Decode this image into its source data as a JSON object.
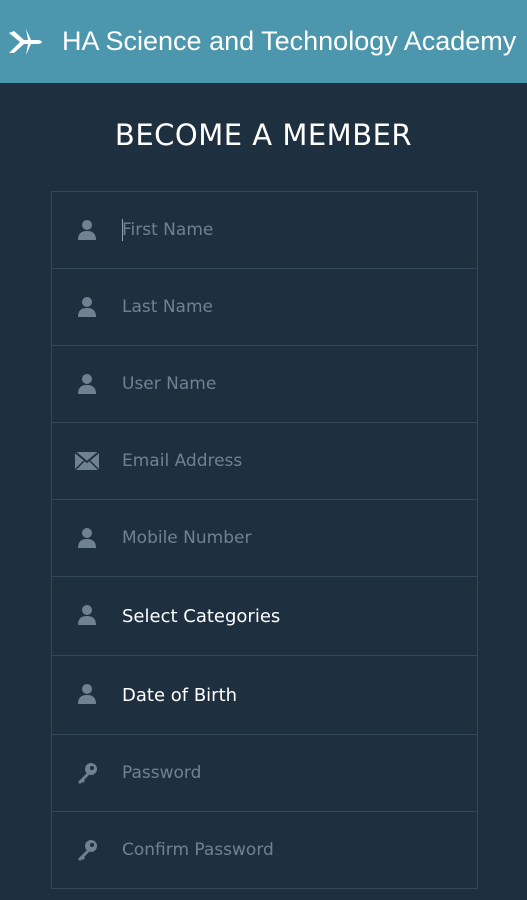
{
  "header": {
    "title": "HA Science and Technology Academy",
    "background": "#4c97ae",
    "logo_icon": "plane-logo-icon"
  },
  "form": {
    "title": "BECOME A MEMBER",
    "fields": [
      {
        "placeholder": "First Name",
        "icon": "person-icon",
        "type": "text"
      },
      {
        "placeholder": "Last Name",
        "icon": "person-icon",
        "type": "text"
      },
      {
        "placeholder": "User Name",
        "icon": "person-icon",
        "type": "text"
      },
      {
        "placeholder": "Email Address",
        "icon": "envelope-icon",
        "type": "email"
      },
      {
        "placeholder": "Mobile Number",
        "icon": "person-icon",
        "type": "tel"
      },
      {
        "label": "Select Categories",
        "icon": "person-icon",
        "type": "select"
      },
      {
        "label": "Date of Birth",
        "icon": "person-icon",
        "type": "select"
      },
      {
        "placeholder": "Password",
        "icon": "key-icon",
        "type": "password"
      },
      {
        "placeholder": "Confirm Password",
        "icon": "key-icon",
        "type": "password"
      }
    ]
  },
  "colors": {
    "background": "#1e2f40",
    "field_border": "#34485c",
    "icon": "#6f8294",
    "placeholder": "#6f8294",
    "text": "#ffffff"
  }
}
